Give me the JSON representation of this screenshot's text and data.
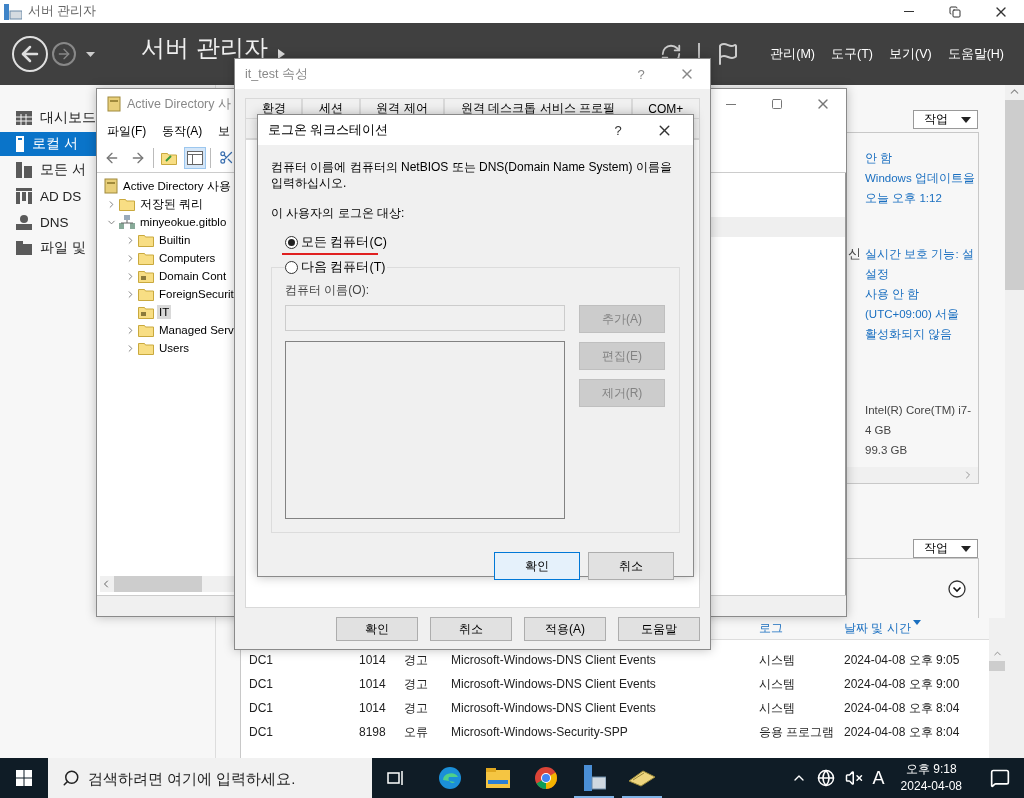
{
  "window": {
    "title": "서버 관리자"
  },
  "header": {
    "breadcrumb": [
      "서버 관리자"
    ],
    "menus": [
      "관리(M)",
      "도구(T)",
      "보기(V)",
      "도움말(H)"
    ]
  },
  "sidebar": {
    "items": [
      {
        "label": "대시보드",
        "kind": "dashboard",
        "selected": false
      },
      {
        "label": "로컬 서",
        "kind": "local",
        "selected": true
      },
      {
        "label": "모든 서",
        "kind": "all",
        "selected": false
      },
      {
        "label": "AD DS",
        "kind": "adds",
        "selected": false
      },
      {
        "label": "DNS",
        "kind": "dns",
        "selected": false
      },
      {
        "label": "파일 및",
        "kind": "files",
        "selected": false
      }
    ]
  },
  "properties": {
    "task_button": "작업",
    "groups": [
      {
        "rows": [
          {
            "value": "안 함",
            "kind": "link"
          },
          {
            "value": "Windows 업데이트을",
            "kind": "link"
          },
          {
            "value": "오늘 오후 1:12",
            "kind": "link"
          }
        ]
      },
      {
        "rows": [
          {
            "label": "신",
            "value": "실시간 보호 기능: 설",
            "kind": "link"
          },
          {
            "value": "설정",
            "kind": "link"
          },
          {
            "value": "사용 안 함",
            "kind": "link"
          },
          {
            "value": "(UTC+09:00) 서울",
            "kind": "link"
          },
          {
            "value": "활성화되지 않음",
            "kind": "link"
          }
        ]
      },
      {
        "rows": [
          {
            "value": "Intel(R) Core(TM) i7-",
            "kind": "plain"
          },
          {
            "value": "4 GB",
            "kind": "plain"
          },
          {
            "value": "99.3 GB",
            "kind": "plain"
          }
        ]
      }
    ]
  },
  "events": {
    "task_button": "작업",
    "columns": [
      "로그",
      "날짜 및 시간"
    ],
    "rows": [
      {
        "server": "DC1",
        "id": "1014",
        "severity": "경고",
        "source": "Microsoft-Windows-DNS Client Events",
        "log": "시스템",
        "time": "2024-04-08 오후 9:05"
      },
      {
        "server": "DC1",
        "id": "1014",
        "severity": "경고",
        "source": "Microsoft-Windows-DNS Client Events",
        "log": "시스템",
        "time": "2024-04-08 오후 9:00"
      },
      {
        "server": "DC1",
        "id": "1014",
        "severity": "경고",
        "source": "Microsoft-Windows-DNS Client Events",
        "log": "시스템",
        "time": "2024-04-08 오후 8:04"
      },
      {
        "server": "DC1",
        "id": "8198",
        "severity": "오류",
        "source": "Microsoft-Windows-Security-SPP",
        "log": "응용 프로그램",
        "time": "2024-04-08 오후 8:04"
      }
    ]
  },
  "ad_window": {
    "title": "Active Directory 사",
    "menus": [
      "파일(F)",
      "동작(A)",
      "보"
    ],
    "tree": [
      {
        "label": "Active Directory 사용",
        "kind": "root",
        "selected": false,
        "children": [
          {
            "label": "저장된 쿼리",
            "kind": "folder",
            "expanded": false,
            "selected": false
          },
          {
            "label": "minyeokue.gitblo",
            "kind": "domain",
            "expanded": true,
            "selected": false,
            "children": [
              {
                "label": "Builtin",
                "kind": "folder",
                "expanded": false,
                "selected": false
              },
              {
                "label": "Computers",
                "kind": "folder",
                "expanded": false,
                "selected": false
              },
              {
                "label": "Domain Cont",
                "kind": "ou",
                "expanded": false,
                "selected": false
              },
              {
                "label": "ForeignSecurit",
                "kind": "folder",
                "expanded": false,
                "selected": false
              },
              {
                "label": "IT",
                "kind": "ou",
                "selected": true
              },
              {
                "label": "Managed Serv",
                "kind": "folder",
                "expanded": false,
                "selected": false
              },
              {
                "label": "Users",
                "kind": "folder",
                "expanded": false,
                "selected": false
              }
            ]
          }
        ]
      }
    ]
  },
  "properties_dialog": {
    "title": "it_test 속성",
    "help_label": "?",
    "tabs": [
      "환경",
      "세션",
      "원격 제어",
      "원격 데스크톱 서비스 프로필",
      "COM+"
    ],
    "buttons": [
      "확인",
      "취소",
      "적용(A)",
      "도움말"
    ]
  },
  "logon_dialog": {
    "title": "로그온 워크스테이션",
    "help_label": "?",
    "instruction": "컴퓨터 이름에 컴퓨터의 NetBIOS 또는 DNS(Domain Name System) 이름을 입력하십시오.",
    "target_label": "이 사용자의 로그온 대상:",
    "options": [
      {
        "label": "모든 컴퓨터(C)",
        "selected": true,
        "underlined": true
      },
      {
        "label": "다음 컴퓨터(T)",
        "selected": false,
        "underlined": false
      }
    ],
    "name_label": "컴퓨터 이름(O):",
    "side_buttons": [
      {
        "label": "추가(A)",
        "disabled": true
      },
      {
        "label": "편집(E)",
        "disabled": true
      },
      {
        "label": "제거(R)",
        "disabled": true
      }
    ],
    "buttons": [
      {
        "label": "확인",
        "default": true
      },
      {
        "label": "취소",
        "default": false
      }
    ]
  },
  "taskbar": {
    "search": {
      "placeholder": "검색하려면 여기에 입력하세요."
    },
    "apps": [
      {
        "kind": "edge",
        "active": false
      },
      {
        "kind": "explorer",
        "active": false
      },
      {
        "kind": "chrome",
        "active": false
      },
      {
        "kind": "server-manager",
        "active": true
      },
      {
        "kind": "ad-tool",
        "active": true
      }
    ],
    "ime": "A",
    "time": "오후 9:18",
    "date": "2024-04-08"
  }
}
